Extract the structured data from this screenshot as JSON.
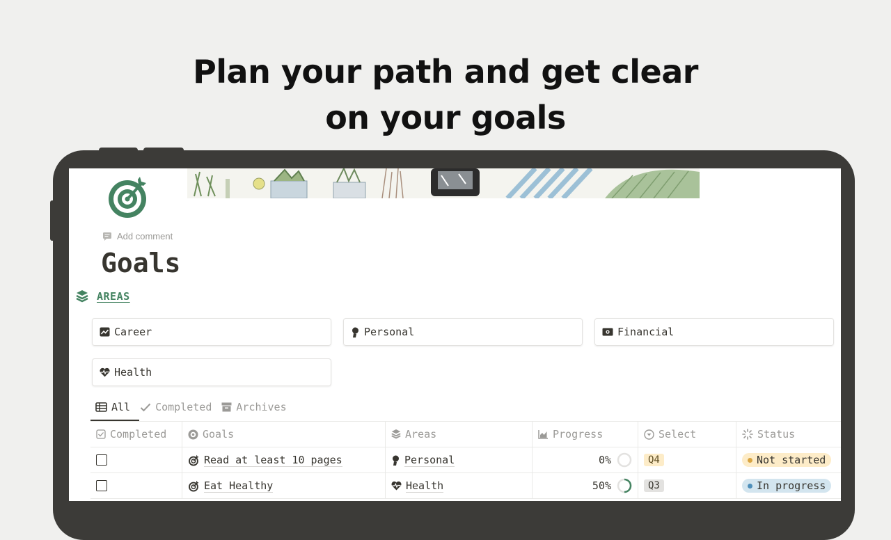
{
  "headline": {
    "line1": "Plan your path and get clear",
    "line2": "on your goals"
  },
  "page": {
    "add_comment": "Add comment",
    "title": "Goals"
  },
  "areas": {
    "label": "AREAS",
    "cards": [
      {
        "icon": "chart-icon",
        "label": "Career"
      },
      {
        "icon": "person-icon",
        "label": "Personal"
      },
      {
        "icon": "money-icon",
        "label": "Financial"
      },
      {
        "icon": "heart-pulse-icon",
        "label": "Health"
      }
    ]
  },
  "views": [
    {
      "icon": "table-icon",
      "label": "All",
      "active": true
    },
    {
      "icon": "check-icon",
      "label": "Completed"
    },
    {
      "icon": "archive-icon",
      "label": "Archives"
    }
  ],
  "table": {
    "columns": [
      "Completed",
      "Goals",
      "Areas",
      "Progress",
      "Select",
      "Status"
    ],
    "rows": [
      {
        "completed": false,
        "goal": "Read at least 10 pages",
        "area": "Personal",
        "progress": "0%",
        "progress_fraction": 0,
        "select": "Q4",
        "status": "Not started"
      },
      {
        "completed": false,
        "goal": "Eat Healthy",
        "area": "Health",
        "progress": "50%",
        "progress_fraction": 0.5,
        "select": "Q3",
        "status": "In progress"
      }
    ]
  },
  "colors": {
    "accent_green": "#448361",
    "q4_bg": "#fdecc8",
    "q3_bg": "#e3e2e0",
    "not_started_bg": "#fdecc8",
    "not_started_dot": "#d9a542",
    "in_progress_bg": "#d3e5ef",
    "in_progress_dot": "#4e8fba"
  }
}
